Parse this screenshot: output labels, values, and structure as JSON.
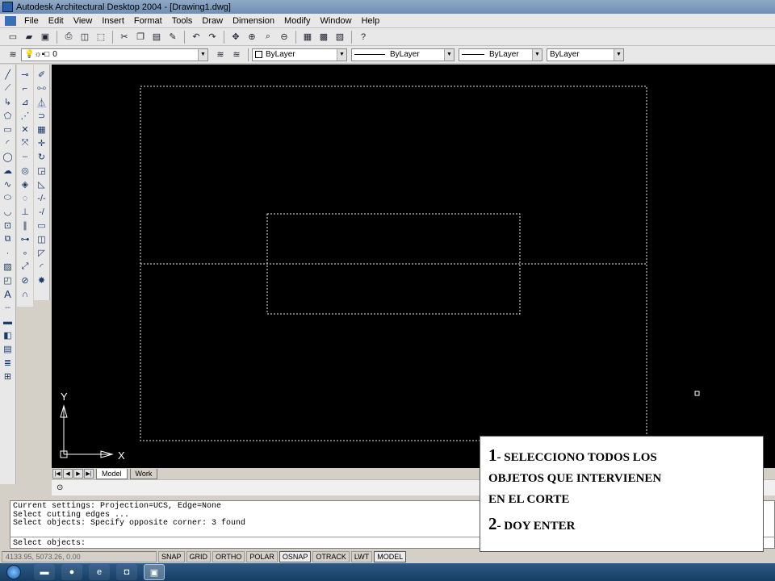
{
  "window": {
    "title": "Autodesk Architectural Desktop 2004 - [Drawing1.dwg]"
  },
  "menu": [
    "File",
    "Edit",
    "View",
    "Insert",
    "Format",
    "Tools",
    "Draw",
    "Dimension",
    "Modify",
    "Window",
    "Help"
  ],
  "layers": {
    "current_layer": "0"
  },
  "properties": {
    "color": "ByLayer",
    "linetype": "ByLayer",
    "lineweight": "ByLayer",
    "plotstyle": "ByLayer"
  },
  "ucs_axes": {
    "y_label": "Y",
    "x_label": "X"
  },
  "layout_tabs": [
    "Model",
    "Work"
  ],
  "command_window": {
    "history": [
      "Current settings: Projection=UCS, Edge=None",
      "Select cutting edges ...",
      "Select objects: Specify opposite corner: 3 found"
    ],
    "prompt": "Select objects:"
  },
  "status": {
    "coordinates": "4133.95, 5073.26, 0.00",
    "toggles": [
      "SNAP",
      "GRID",
      "ORTHO",
      "POLAR",
      "OSNAP",
      "OTRACK",
      "LWT",
      "MODEL"
    ],
    "active": [
      "OSNAP",
      "MODEL"
    ]
  },
  "annotation": {
    "step1_number": "1",
    "step1_lines": [
      "- SELECCIONO TODOS LOS",
      "OBJETOS QUE INTERVIENEN",
      "EN EL CORTE"
    ],
    "step2_number": "2",
    "step2_text": "- DOY ENTER"
  },
  "taskbar": {
    "apps": [
      "windows-explorer-icon",
      "media-player-icon",
      "internet-explorer-icon",
      "office-icon",
      "autocad-icon"
    ]
  }
}
